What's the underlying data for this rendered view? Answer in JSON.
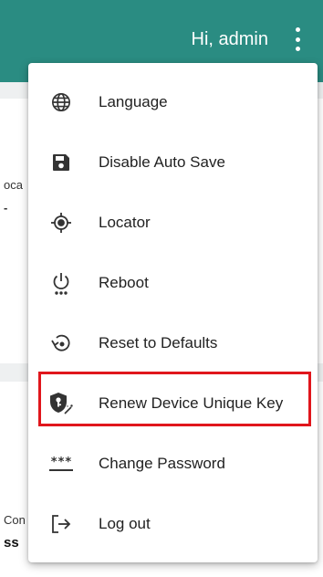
{
  "header": {
    "greeting": "Hi, admin",
    "background_color": "#2a8c82"
  },
  "background_page": {
    "fragment_1": "oca",
    "fragment_2": "-",
    "fragment_3": "Con",
    "fragment_4": "ss"
  },
  "menu": {
    "items": [
      {
        "label": "Language",
        "icon": "globe-icon"
      },
      {
        "label": "Disable Auto Save",
        "icon": "save-icon"
      },
      {
        "label": "Locator",
        "icon": "locator-icon"
      },
      {
        "label": "Reboot",
        "icon": "power-icon"
      },
      {
        "label": "Reset to Defaults",
        "icon": "reset-icon"
      },
      {
        "label": "Renew Device Unique Key",
        "icon": "key-shield-icon",
        "highlighted": true
      },
      {
        "label": "Change Password",
        "icon": "password-icon",
        "glyph": "***"
      },
      {
        "label": "Log out",
        "icon": "logout-icon"
      }
    ],
    "highlight_color": "#e0161c"
  }
}
